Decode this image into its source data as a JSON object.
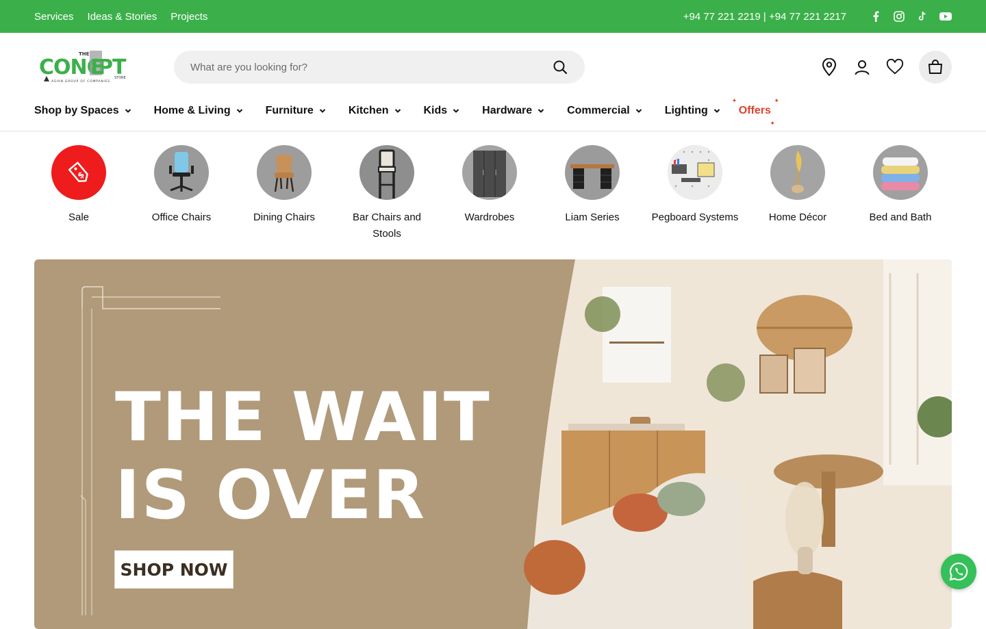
{
  "topbar": {
    "links": [
      "Services",
      "Ideas & Stories",
      "Projects"
    ],
    "phone": "+94 77 221 2219 | +94 77 221 2217",
    "social_icons": [
      "facebook-icon",
      "instagram-icon",
      "tiktok-icon",
      "youtube-icon"
    ],
    "bg_color": "#3bb04a"
  },
  "header": {
    "logo_text": "THE CONCEPT STORE",
    "search_placeholder": "What are you looking for?",
    "icons": [
      "store-locator-icon",
      "account-icon",
      "wishlist-icon",
      "cart-icon"
    ]
  },
  "nav": {
    "items": [
      "Shop by Spaces",
      "Home & Living",
      "Furniture",
      "Kitchen",
      "Kids",
      "Hardware",
      "Commercial",
      "Lighting"
    ],
    "offers_label": "Offers",
    "offers_color": "#e0402b"
  },
  "categories": [
    {
      "label": "Sale"
    },
    {
      "label": "Office Chairs"
    },
    {
      "label": "Dining Chairs"
    },
    {
      "label": "Bar Chairs and Stools"
    },
    {
      "label": "Wardrobes"
    },
    {
      "label": "Liam Series"
    },
    {
      "label": "Pegboard Systems"
    },
    {
      "label": "Home Décor"
    },
    {
      "label": "Bed and Bath"
    }
  ],
  "banner": {
    "headline_line1": "THE WAIT",
    "headline_line2": "IS OVER",
    "cta_label": "SHOP NOW",
    "bg_color": "#b09a7a"
  },
  "whatsapp": {
    "icon": "whatsapp-icon",
    "color": "#35c05a"
  }
}
